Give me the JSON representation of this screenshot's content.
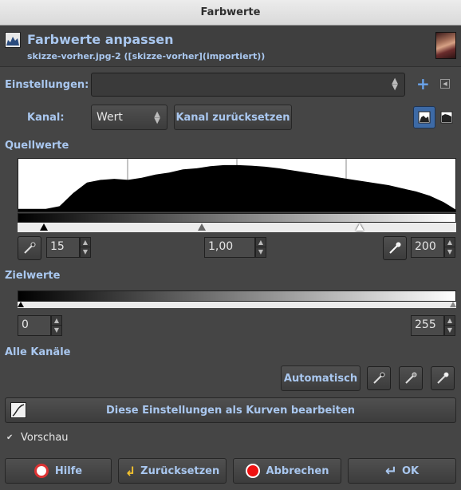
{
  "window": {
    "title": "Farbwerte"
  },
  "header": {
    "title": "Farbwerte anpassen",
    "subtitle": "skizze-vorher.jpg-2 ([skizze-vorher](importiert))"
  },
  "settings": {
    "label": "Einstellungen:",
    "value": ""
  },
  "channel": {
    "label": "Kanal:",
    "value": "Wert",
    "reset_label": "Kanal zurücksetzen"
  },
  "input_levels": {
    "label": "Quellwerte",
    "low": "15",
    "gamma": "1,00",
    "high": "200"
  },
  "output_levels": {
    "label": "Zielwerte",
    "low": "0",
    "high": "255"
  },
  "all_channels": {
    "label": "Alle Kanäle",
    "auto_label": "Automatisch"
  },
  "curves_button": {
    "label": "Diese Einstellungen als Kurven bearbeiten"
  },
  "preview": {
    "label": "Vorschau",
    "checked": true
  },
  "footer": {
    "help": "Hilfe",
    "reset": "Zurücksetzen",
    "cancel": "Abbrechen",
    "ok": "OK"
  },
  "chart_data": {
    "type": "area",
    "x": [
      0,
      8,
      16,
      24,
      32,
      40,
      48,
      56,
      64,
      72,
      80,
      88,
      96,
      104,
      112,
      120,
      128,
      136,
      144,
      152,
      160,
      168,
      176,
      184,
      192,
      200,
      208,
      216,
      224,
      232,
      240,
      248,
      255
    ],
    "values": [
      5,
      5,
      5,
      10,
      35,
      55,
      60,
      62,
      60,
      64,
      70,
      74,
      80,
      82,
      86,
      88,
      88,
      87,
      85,
      82,
      78,
      74,
      70,
      66,
      62,
      58,
      54,
      50,
      44,
      38,
      30,
      18,
      4
    ],
    "ylim": [
      0,
      100
    ],
    "xlim": [
      0,
      255
    ],
    "grid": true
  }
}
